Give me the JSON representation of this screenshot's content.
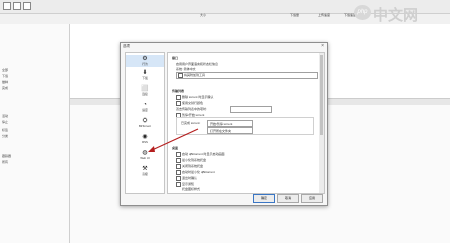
{
  "app": {
    "columns": [
      "大小",
      "下载量",
      "上传速度",
      "下载速度"
    ],
    "left_tree": [
      "全部",
      "下载",
      "做种",
      "完成",
      "活动",
      "停止",
      "标签",
      "分类",
      "跟踪器",
      "所有"
    ]
  },
  "watermark": {
    "logo": "php",
    "text": "中文网"
  },
  "dialog": {
    "title": "选项",
    "close": "×",
    "sidebar": [
      {
        "label": "行为",
        "icon": "gear-icon",
        "glyph": "⚙"
      },
      {
        "label": "下载",
        "icon": "download-icon",
        "glyph": "⬇"
      },
      {
        "label": "连接",
        "icon": "connection-icon",
        "glyph": "⬜"
      },
      {
        "label": "速度",
        "icon": "speed-icon",
        "glyph": "◔"
      },
      {
        "label": "BitTorrent",
        "icon": "bittorrent-icon",
        "glyph": "⛭"
      },
      {
        "label": "RSS",
        "icon": "rss-icon",
        "glyph": "◉"
      },
      {
        "label": "Web UI",
        "icon": "webui-icon",
        "glyph": "◍"
      },
      {
        "label": "高级",
        "icon": "advanced-icon",
        "glyph": "⚒"
      }
    ],
    "panel": {
      "section1": "接口",
      "s1_line1": "启用用户界面语言和状态栏信息",
      "s1_label": "系统: 简体中文",
      "s1_check": "将其附加到工具",
      "section2": "传输列表",
      "s2_items": [
        "删除 torrent 时显示确认",
        "使用交替行颜色",
        "双击传输列表中的项时:",
        "暂停/开始 torrent"
      ],
      "s2_double_click_value": "开始/暂停 torrent",
      "s2_completed_label": "已完成 torrent:",
      "s2_completed_value": "打开所在文件夹",
      "section3": "桌面",
      "s3_items": [
        "启动 qBittorrent 时显示启动画面",
        "最小化到系统托盘",
        "关闭到系统托盘",
        "启动时最小化 qBittorrent",
        "退出时确认",
        "显示通知",
        "托盘图标样式"
      ]
    },
    "buttons": {
      "ok": "确定",
      "cancel": "取消",
      "apply": "应用"
    }
  },
  "colors": {
    "accent_arrow": "#b51f1f",
    "selected": "#d6e6f7"
  }
}
